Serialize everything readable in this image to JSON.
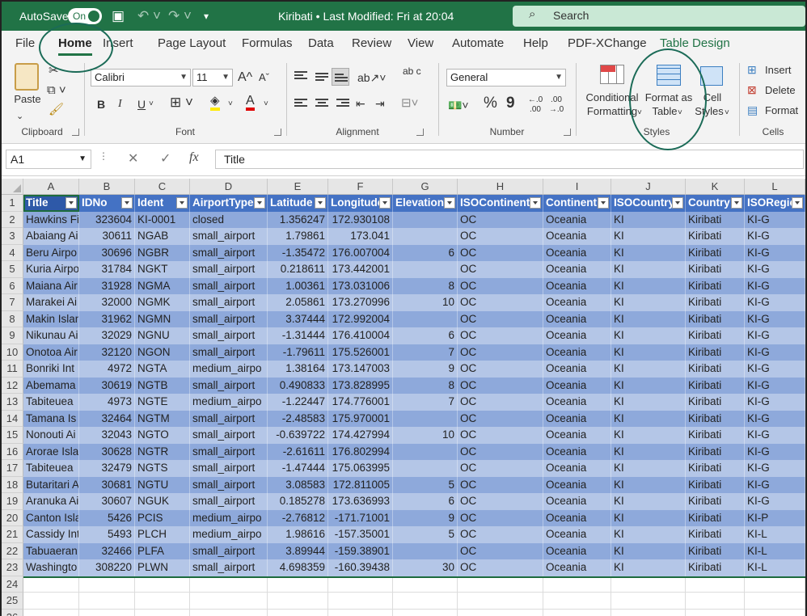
{
  "titlebar": {
    "autosave_label": "AutoSave",
    "autosave_state": "On",
    "title": "Kiribati • Last Modified: Fri at 20:04",
    "search_placeholder": "Search"
  },
  "tabs": [
    {
      "label": "File"
    },
    {
      "label": "Home",
      "active": true
    },
    {
      "label": "Insert"
    },
    {
      "label": "Page Layout"
    },
    {
      "label": "Formulas"
    },
    {
      "label": "Data"
    },
    {
      "label": "Review"
    },
    {
      "label": "View"
    },
    {
      "label": "Automate"
    },
    {
      "label": "Help"
    },
    {
      "label": "PDF-XChange"
    },
    {
      "label": "Table Design",
      "contextual": true
    }
  ],
  "ribbon": {
    "clipboard": {
      "label": "Clipboard",
      "paste": "Paste"
    },
    "font": {
      "label": "Font",
      "family": "Calibri",
      "size": "11",
      "bold": "B",
      "italic": "I",
      "underline": "U",
      "grow": "A^",
      "shrink": "Aˇ"
    },
    "alignment": {
      "label": "Alignment",
      "wrap": "ab c"
    },
    "number": {
      "label": "Number",
      "format": "General",
      "percent": "%",
      "comma": "9",
      "inc_decimal": "←.0 .00",
      "dec_decimal": ".00 →.0"
    },
    "styles": {
      "label": "Styles",
      "conditional": "Conditional",
      "conditional2": "Formatting",
      "format_table": "Format as",
      "format_table2": "Table",
      "cell_styles": "Cell",
      "cell_styles2": "Styles"
    },
    "cells": {
      "label": "Cells",
      "insert": "Insert",
      "delete": "Delete",
      "format": "Format"
    }
  },
  "formula_bar": {
    "name_box": "A1",
    "fx": "fx",
    "content": "Title"
  },
  "columns": [
    "A",
    "B",
    "C",
    "D",
    "E",
    "F",
    "G",
    "H",
    "I",
    "J",
    "K",
    "L"
  ],
  "headers": [
    "Title",
    "IDNo",
    "Ident",
    "AirportType",
    "Latitude",
    "Longitude",
    "Elevation",
    "ISOContinent",
    "Continent",
    "ISOCountry",
    "Country",
    "ISORegion"
  ],
  "rows": [
    [
      "Hawkins Fi",
      "323604",
      "KI-0001",
      "closed",
      "1.356247",
      "172.930108",
      "",
      "OC",
      "Oceania",
      "KI",
      "Kiribati",
      "KI-G"
    ],
    [
      "Abaiang Ai",
      "30611",
      "NGAB",
      "small_airport",
      "1.79861",
      "173.041",
      "",
      "OC",
      "Oceania",
      "KI",
      "Kiribati",
      "KI-G"
    ],
    [
      "Beru Airpo",
      "30696",
      "NGBR",
      "small_airport",
      "-1.35472",
      "176.007004",
      "6",
      "OC",
      "Oceania",
      "KI",
      "Kiribati",
      "KI-G"
    ],
    [
      "Kuria Airpo",
      "31784",
      "NGKT",
      "small_airport",
      "0.218611",
      "173.442001",
      "",
      "OC",
      "Oceania",
      "KI",
      "Kiribati",
      "KI-G"
    ],
    [
      "Maiana Air",
      "31928",
      "NGMA",
      "small_airport",
      "1.00361",
      "173.031006",
      "8",
      "OC",
      "Oceania",
      "KI",
      "Kiribati",
      "KI-G"
    ],
    [
      "Marakei Ai",
      "32000",
      "NGMK",
      "small_airport",
      "2.05861",
      "173.270996",
      "10",
      "OC",
      "Oceania",
      "KI",
      "Kiribati",
      "KI-G"
    ],
    [
      "Makin Islan",
      "31962",
      "NGMN",
      "small_airport",
      "3.37444",
      "172.992004",
      "",
      "OC",
      "Oceania",
      "KI",
      "Kiribati",
      "KI-G"
    ],
    [
      "Nikunau Ai",
      "32029",
      "NGNU",
      "small_airport",
      "-1.31444",
      "176.410004",
      "6",
      "OC",
      "Oceania",
      "KI",
      "Kiribati",
      "KI-G"
    ],
    [
      "Onotoa Air",
      "32120",
      "NGON",
      "small_airport",
      "-1.79611",
      "175.526001",
      "7",
      "OC",
      "Oceania",
      "KI",
      "Kiribati",
      "KI-G"
    ],
    [
      "Bonriki Int",
      "4972",
      "NGTA",
      "medium_airpo",
      "1.38164",
      "173.147003",
      "9",
      "OC",
      "Oceania",
      "KI",
      "Kiribati",
      "KI-G"
    ],
    [
      "Abemama",
      "30619",
      "NGTB",
      "small_airport",
      "0.490833",
      "173.828995",
      "8",
      "OC",
      "Oceania",
      "KI",
      "Kiribati",
      "KI-G"
    ],
    [
      "Tabiteuea",
      "4973",
      "NGTE",
      "medium_airpo",
      "-1.22447",
      "174.776001",
      "7",
      "OC",
      "Oceania",
      "KI",
      "Kiribati",
      "KI-G"
    ],
    [
      "Tamana Is",
      "32464",
      "NGTM",
      "small_airport",
      "-2.48583",
      "175.970001",
      "",
      "OC",
      "Oceania",
      "KI",
      "Kiribati",
      "KI-G"
    ],
    [
      "Nonouti Ai",
      "32043",
      "NGTO",
      "small_airport",
      "-0.639722",
      "174.427994",
      "10",
      "OC",
      "Oceania",
      "KI",
      "Kiribati",
      "KI-G"
    ],
    [
      "Arorae Isla",
      "30628",
      "NGTR",
      "small_airport",
      "-2.61611",
      "176.802994",
      "",
      "OC",
      "Oceania",
      "KI",
      "Kiribati",
      "KI-G"
    ],
    [
      "Tabiteuea",
      "32479",
      "NGTS",
      "small_airport",
      "-1.47444",
      "175.063995",
      "",
      "OC",
      "Oceania",
      "KI",
      "Kiribati",
      "KI-G"
    ],
    [
      "Butaritari A",
      "30681",
      "NGTU",
      "small_airport",
      "3.08583",
      "172.811005",
      "5",
      "OC",
      "Oceania",
      "KI",
      "Kiribati",
      "KI-G"
    ],
    [
      "Aranuka Ai",
      "30607",
      "NGUK",
      "small_airport",
      "0.185278",
      "173.636993",
      "6",
      "OC",
      "Oceania",
      "KI",
      "Kiribati",
      "KI-G"
    ],
    [
      "Canton Isla",
      "5426",
      "PCIS",
      "medium_airpo",
      "-2.76812",
      "-171.71001",
      "9",
      "OC",
      "Oceania",
      "KI",
      "Kiribati",
      "KI-P"
    ],
    [
      "Cassidy Int",
      "5493",
      "PLCH",
      "medium_airpo",
      "1.98616",
      "-157.35001",
      "5",
      "OC",
      "Oceania",
      "KI",
      "Kiribati",
      "KI-L"
    ],
    [
      "Tabuaeran",
      "32466",
      "PLFA",
      "small_airport",
      "3.89944",
      "-159.38901",
      "",
      "OC",
      "Oceania",
      "KI",
      "Kiribati",
      "KI-L"
    ],
    [
      "Washingto",
      "308220",
      "PLWN",
      "small_airport",
      "4.698359",
      "-160.39438",
      "30",
      "OC",
      "Oceania",
      "KI",
      "Kiribati",
      "KI-L"
    ]
  ],
  "row_numbers": [
    "1",
    "2",
    "3",
    "4",
    "5",
    "6",
    "7",
    "8",
    "9",
    "10",
    "11",
    "12",
    "13",
    "14",
    "15",
    "16",
    "17",
    "18",
    "19",
    "20",
    "21",
    "22",
    "23",
    "24",
    "25",
    "26"
  ],
  "colors": {
    "brand": "#217346",
    "header_band": "#4472c4",
    "band_dark": "#8ea9db",
    "band_light": "#b4c6e7",
    "annotation": "#1b6b57"
  }
}
